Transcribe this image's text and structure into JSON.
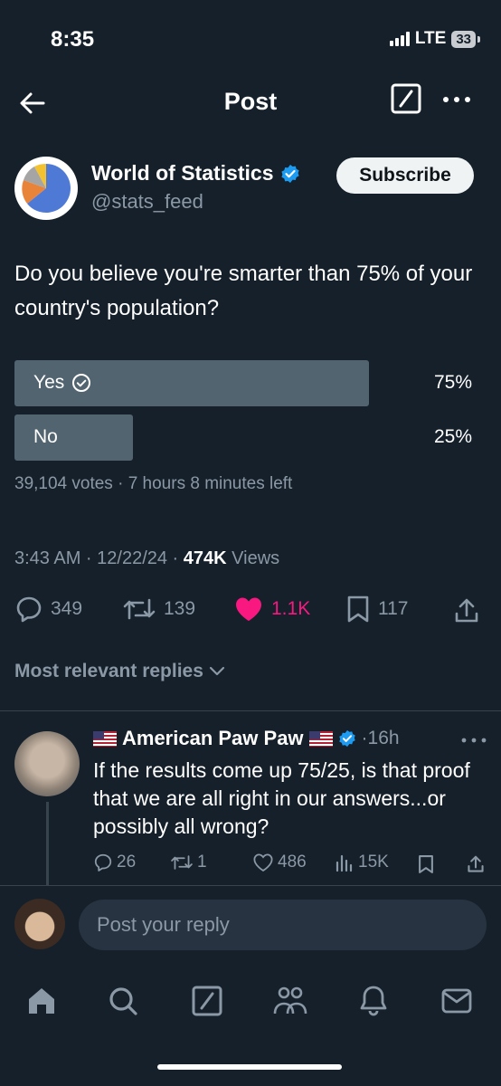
{
  "status": {
    "time": "8:35",
    "network": "LTE",
    "battery": "33"
  },
  "nav": {
    "title": "Post"
  },
  "author": {
    "name": "World of Statistics",
    "handle": "@stats_feed",
    "subscribe_label": "Subscribe"
  },
  "post": {
    "question": "Do you believe you're smarter than 75% of your country's population?",
    "poll": {
      "options": [
        {
          "label": "Yes",
          "percent_label": "75%",
          "fraction": 0.75,
          "selected": true
        },
        {
          "label": "No",
          "percent_label": "25%",
          "fraction": 0.25,
          "selected": false
        }
      ],
      "meta": "39,104 votes · 7 hours 8 minutes left"
    },
    "time": "3:43 AM · 12/22/24 · ",
    "views": "474K",
    "views_label": " Views",
    "stats": {
      "replies": "349",
      "reposts": "139",
      "likes": "1.1K",
      "bookmarks": "117"
    }
  },
  "replies_filter": "Most relevant replies",
  "reply": {
    "name": "American Paw Paw",
    "time": "·16h",
    "text": "If the results come up 75/25, is that proof that we are all right in our answers...or possibly all wrong?",
    "stats": {
      "replies": "26",
      "reposts": "1",
      "likes": "486",
      "views": "15K"
    }
  },
  "composer": {
    "placeholder": "Post your reply"
  },
  "colors": {
    "background": "#15202b",
    "accent": "#1d9bf0",
    "like": "#f91880",
    "poll_bar": "#536471"
  }
}
